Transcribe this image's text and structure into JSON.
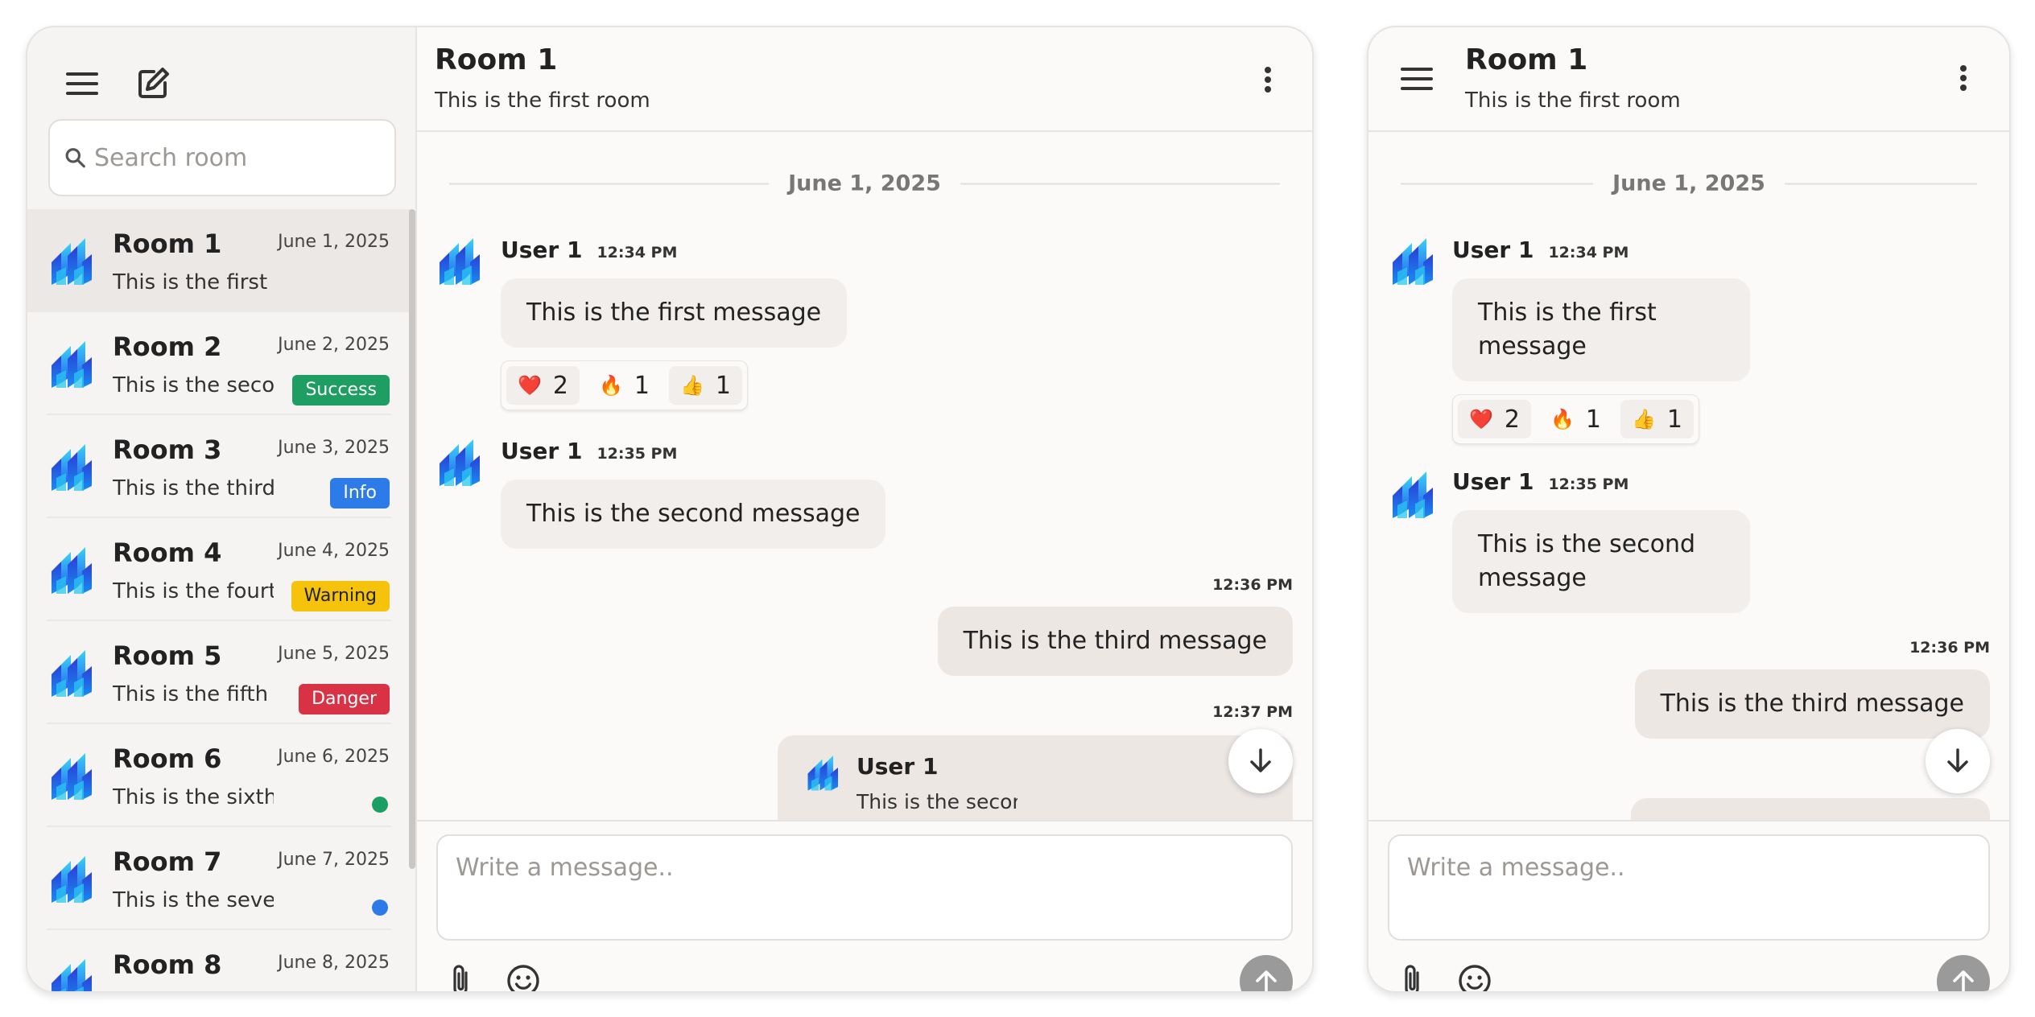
{
  "colors": {
    "success": "#1e9e63",
    "info": "#2d7be8",
    "warning": "#f5c20c",
    "danger": "#d93245",
    "accent_blue": "#2d6ef0"
  },
  "icons": {
    "menu": "menu-icon",
    "new_chat": "edit-icon",
    "search": "search-icon",
    "more": "kebab-icon",
    "attach": "paperclip-icon",
    "emoji": "smiley-icon",
    "send": "arrow-up-icon",
    "scroll_down": "arrow-down-icon"
  },
  "sidebar": {
    "search_placeholder": "Search room",
    "rooms": [
      {
        "name": "Room 1",
        "date": "June 1, 2025",
        "last": "This is the first message"
      },
      {
        "name": "Room 2",
        "date": "June 2, 2025",
        "last": "This is the second message",
        "badge": "Success"
      },
      {
        "name": "Room 3",
        "date": "June 3, 2025",
        "last": "This is the third message",
        "badge": "Info"
      },
      {
        "name": "Room 4",
        "date": "June 4, 2025",
        "last": "This is the fourth message",
        "badge": "Warning"
      },
      {
        "name": "Room 5",
        "date": "June 5, 2025",
        "last": "This is the fifth message",
        "badge": "Danger"
      },
      {
        "name": "Room 6",
        "date": "June 6, 2025",
        "last": "This is the sixth message"
      },
      {
        "name": "Room 7",
        "date": "June 7, 2025",
        "last": "This is the seventh message"
      },
      {
        "name": "Room 8",
        "date": "June 8, 2025",
        "last": ""
      }
    ]
  },
  "chat": {
    "title": "Room 1",
    "subtitle": "This is the first room",
    "date_separator": "June 1, 2025",
    "messages": [
      {
        "author": "User 1",
        "time": "12:34 PM",
        "text": "This is the first message"
      },
      {
        "author": "User 1",
        "time": "12:35 PM",
        "text": "This is the second message"
      },
      {
        "author": "",
        "time": "12:36 PM",
        "text": "This is the third message"
      },
      {
        "author": "",
        "time": "12:37 PM",
        "reply_author": "User 1",
        "reply_text": "This is the second message"
      }
    ],
    "reactions": [
      {
        "emoji": "❤️",
        "count": "2"
      },
      {
        "emoji": "🔥",
        "count": "1"
      },
      {
        "emoji": "👍",
        "count": "1"
      }
    ],
    "composer_placeholder": "Write a message.."
  }
}
